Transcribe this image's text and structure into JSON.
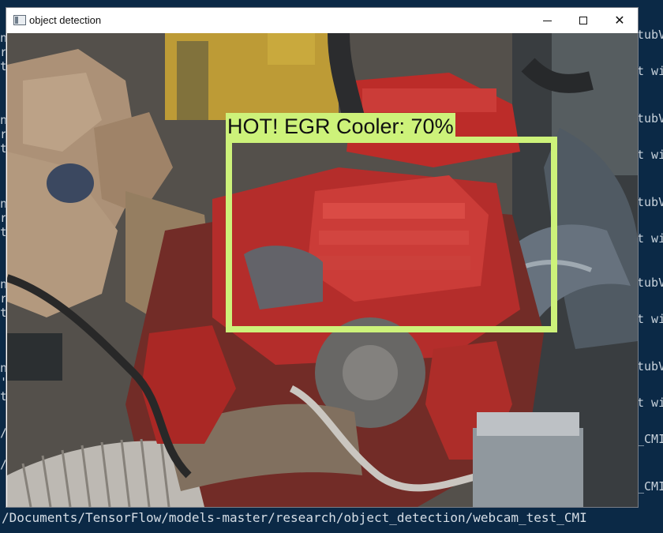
{
  "terminal": {
    "right_fragments": [
      "tubV",
      "t wi",
      "tubV",
      "t wi",
      "tubV",
      "t wi",
      "tubV",
      "t wi",
      "tubV",
      "t wi",
      "_CMI",
      "_CMI"
    ],
    "left_fragments": [
      "n",
      "r",
      "t",
      "n",
      "r",
      "t",
      "n",
      "r",
      "t",
      "n",
      "r",
      "t",
      "n",
      "'",
      "t",
      "/",
      "/"
    ],
    "bottom_line": "/Documents/TensorFlow/models-master/research/object_detection/webcam_test_CMI"
  },
  "window": {
    "title": "object detection",
    "controls": {
      "minimize": "—",
      "maximize": "□",
      "close": "✕"
    }
  },
  "detection": {
    "label": "HOT! EGR Cooler: 70%",
    "box_color": "#cdf27a"
  }
}
